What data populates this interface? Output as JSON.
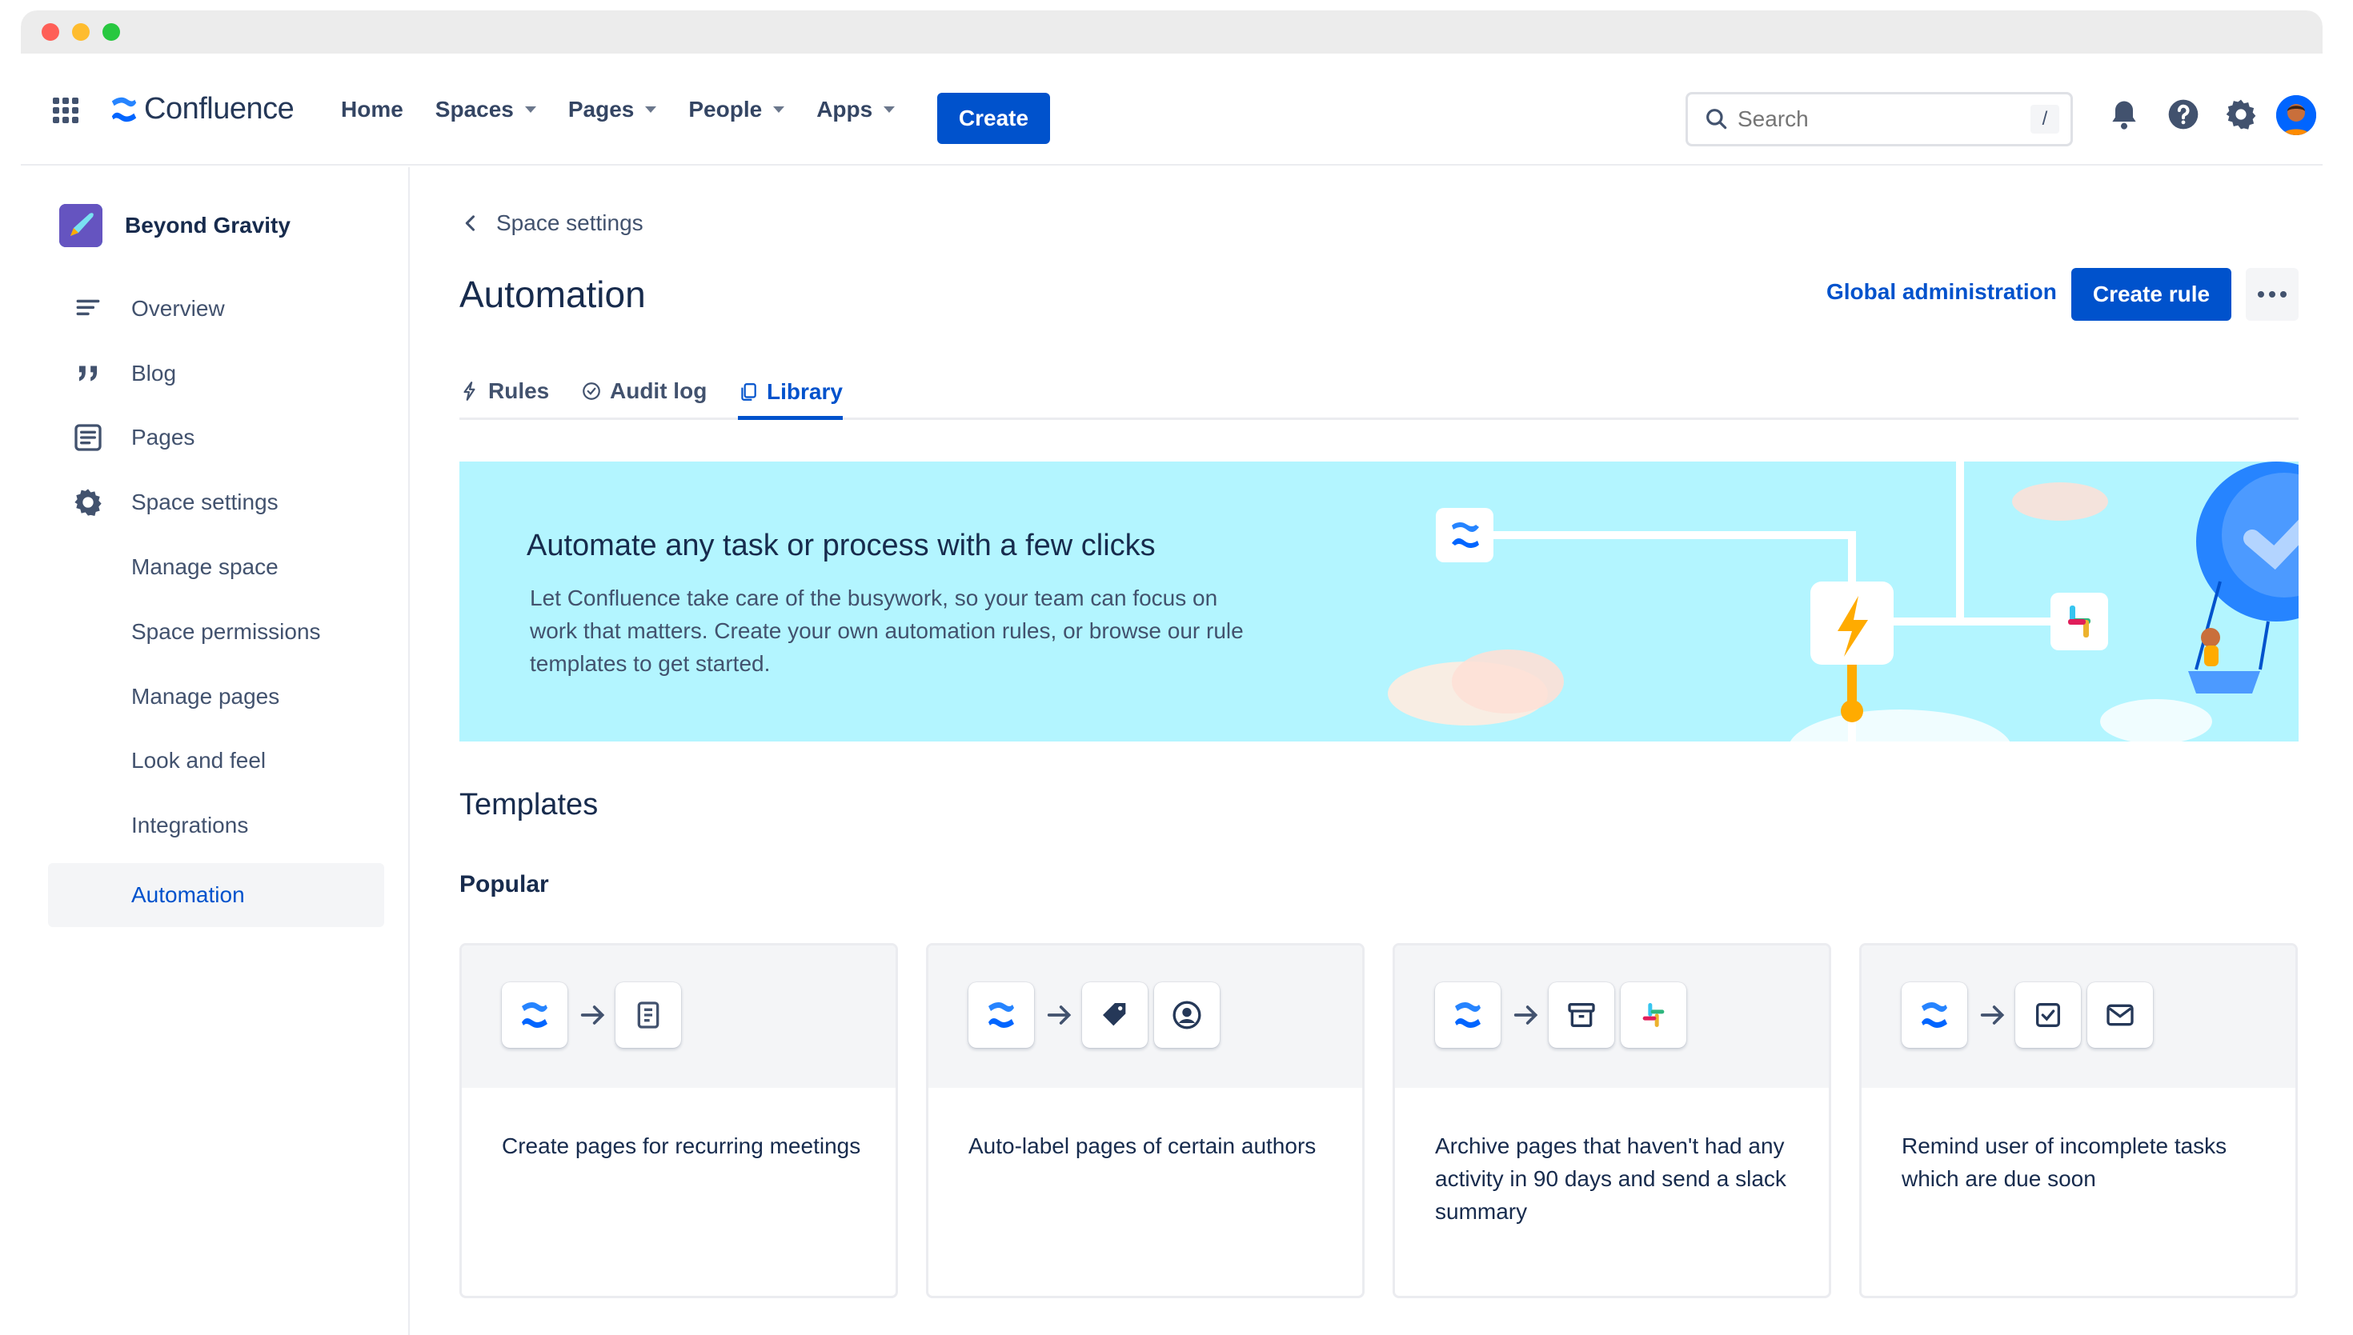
{
  "nav": {
    "brand": "Confluence",
    "links": [
      {
        "label": "Home",
        "dropdown": false
      },
      {
        "label": "Spaces",
        "dropdown": true
      },
      {
        "label": "Pages",
        "dropdown": true
      },
      {
        "label": "People",
        "dropdown": true
      },
      {
        "label": "Apps",
        "dropdown": true
      }
    ],
    "create_label": "Create",
    "search_placeholder": "Search",
    "search_shortcut": "/"
  },
  "sidebar": {
    "space_name": "Beyond Gravity",
    "items": [
      {
        "label": "Overview",
        "icon": "overview-icon"
      },
      {
        "label": "Blog",
        "icon": "quote-icon"
      },
      {
        "label": "Pages",
        "icon": "pages-icon"
      },
      {
        "label": "Space settings",
        "icon": "gear-icon"
      },
      {
        "label": "Manage space"
      },
      {
        "label": "Space permissions"
      },
      {
        "label": "Manage pages"
      },
      {
        "label": "Look and feel"
      },
      {
        "label": "Integrations"
      },
      {
        "label": "Automation",
        "active": true
      }
    ]
  },
  "main": {
    "back_label": "Space settings",
    "title": "Automation",
    "global_admin_label": "Global administration",
    "create_rule_label": "Create rule",
    "tabs": [
      {
        "label": "Rules",
        "icon": "bolt-icon"
      },
      {
        "label": "Audit log",
        "icon": "check-circle-icon"
      },
      {
        "label": "Library",
        "icon": "copy-icon",
        "active": true
      }
    ],
    "banner": {
      "title": "Automate any task or process with a few clicks",
      "text": "Let Confluence take care of the busywork, so your team can focus on work that matters. Create your own automation rules, or browse our rule templates to get started."
    },
    "templates_title": "Templates",
    "popular_title": "Popular",
    "cards": [
      {
        "text": "Create pages for recurring meetings",
        "icons": [
          "confluence-icon",
          "page-icon"
        ]
      },
      {
        "text": "Auto-label pages of certain authors",
        "icons": [
          "confluence-icon",
          "tag-icon",
          "user-circle-icon"
        ]
      },
      {
        "text": "Archive pages that haven't had any activity in 90 days and send a slack summary",
        "icons": [
          "confluence-icon",
          "archive-icon",
          "slack-icon"
        ]
      },
      {
        "text": "Remind user of incomplete tasks which are due soon",
        "icons": [
          "confluence-icon",
          "checkbox-icon",
          "mail-icon"
        ]
      }
    ]
  },
  "colors": {
    "brand_blue": "#0052cc",
    "banner_bg": "#b3f5ff",
    "text_primary": "#172b4d",
    "text_secondary": "#42526e"
  }
}
